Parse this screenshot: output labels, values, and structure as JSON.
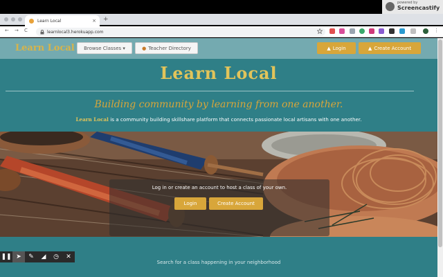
{
  "browser": {
    "tab_title": "Learn Local",
    "tab_close": "×",
    "new_tab": "+",
    "url": "learnlocal3.herokuapp.com",
    "nav": {
      "back": "←",
      "forward": "→",
      "reload": "C"
    }
  },
  "recorder": {
    "badge_small": "powered by",
    "badge_big": "Screencastify",
    "tools": [
      "pause-icon",
      "cursor-icon",
      "pen-icon",
      "eraser-icon",
      "timer-icon",
      "close-icon"
    ]
  },
  "navbar": {
    "brand": "Learn Local",
    "browse_classes": "Browse Classes ▾",
    "teacher_directory": "Teacher Directory",
    "login": "Login",
    "create_account": "Create Account"
  },
  "hero": {
    "title": "Learn Local",
    "tagline": "Building community by learning from one another.",
    "desc_brand": "Learn Local",
    "desc_rest": "is a community building skillshare platform that connects passionate local artisans with one another.",
    "cta_text": "Log in or create an account to host a class of your own.",
    "cta_login": "Login",
    "cta_create": "Create Account"
  },
  "search": {
    "hint": "Search for a class happening in your neighborhood"
  },
  "colors": {
    "teal": "#2f7f87",
    "navbar": "#74aab0",
    "gold": "#d8a63a",
    "title_gold": "#e2c45a"
  }
}
